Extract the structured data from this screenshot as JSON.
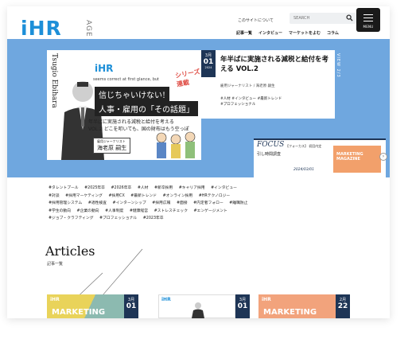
{
  "header": {
    "logo_text": "iHR",
    "logo_sub": "AGE",
    "about_link": "このサイトについて",
    "search_placeholder": "SEARCH",
    "menu_label": "MENU",
    "nav": [
      "記事一覧",
      "インタビュー",
      "マーケットをよむ",
      "コラム"
    ]
  },
  "hero": {
    "counter": "VIEW 2/3",
    "image": {
      "vertical_name": "Tsugio Ebihara",
      "logo": "iHR",
      "series_sub": "seems correct at first glance, but",
      "series": "シリーズ連載",
      "title_line1": "信じちゃいけない!",
      "title_line2": "人事・雇用の「その話題」",
      "desc_line1": "年半ばに実施される減税と給付を考える",
      "desc_line2": "VOL.2 どこを叩いても、国の財布はもう空っぽ",
      "author_role": "雇用ジャーナリスト",
      "author_name": "海老原 嗣生"
    },
    "card": {
      "month": "3月",
      "day": "01",
      "year": "2024",
      "title": "年半ばに実施される減税と給付を考える VOL.2",
      "byline": "雇用ジャーナリスト / 海老原 嗣生",
      "tags": [
        "#人材",
        "#インタビュー",
        "#最新トレンド",
        "#プロフェッショナル"
      ]
    },
    "focus": {
      "heading": "FOCUS",
      "heading_sub": "【フォーカス】 初回内定",
      "text": "引し時間調査",
      "date": "2024/03/01",
      "magazine": "MARKETING MAGAZINE",
      "arrow": "›"
    }
  },
  "tags": [
    "#タレントプール",
    "#2025年卒",
    "#2026年卒",
    "#人材",
    "#新卒採用",
    "#キャリア採用",
    "#インタビュー",
    "#対談",
    "#採用マーケティング",
    "#採用CX",
    "#最新トレンド",
    "#オンライン採用",
    "#HRテクノロジー",
    "#採用管理システム",
    "#適性検査",
    "#インターンシップ",
    "#採用広報",
    "#面接",
    "#内定者フォロー",
    "#離職防止",
    "#学生の動向",
    "#企業の動向",
    "#人事制度",
    "#健康経営",
    "#ストレスチェック",
    "#エンゲージメント",
    "#ジョブ・クラフティング",
    "#プロフェッショナル",
    "#2023年卒"
  ],
  "articles": {
    "title": "Articles",
    "subtitle": "記事一覧",
    "cards": [
      {
        "label": "MARKETING",
        "logo": "iHR",
        "month": "3月",
        "day": "01",
        "color": "#e9d35a"
      },
      {
        "label": "",
        "logo": "iHR",
        "month": "3月",
        "day": "01",
        "color": "#ffffff"
      },
      {
        "label": "MARKETING",
        "logo": "iHR",
        "month": "2月",
        "day": "22",
        "color": "#f2a37c"
      }
    ]
  },
  "colors": {
    "brand": "#1d8fd8",
    "navy": "#1e3556",
    "hero_bg": "#6fa7df"
  }
}
